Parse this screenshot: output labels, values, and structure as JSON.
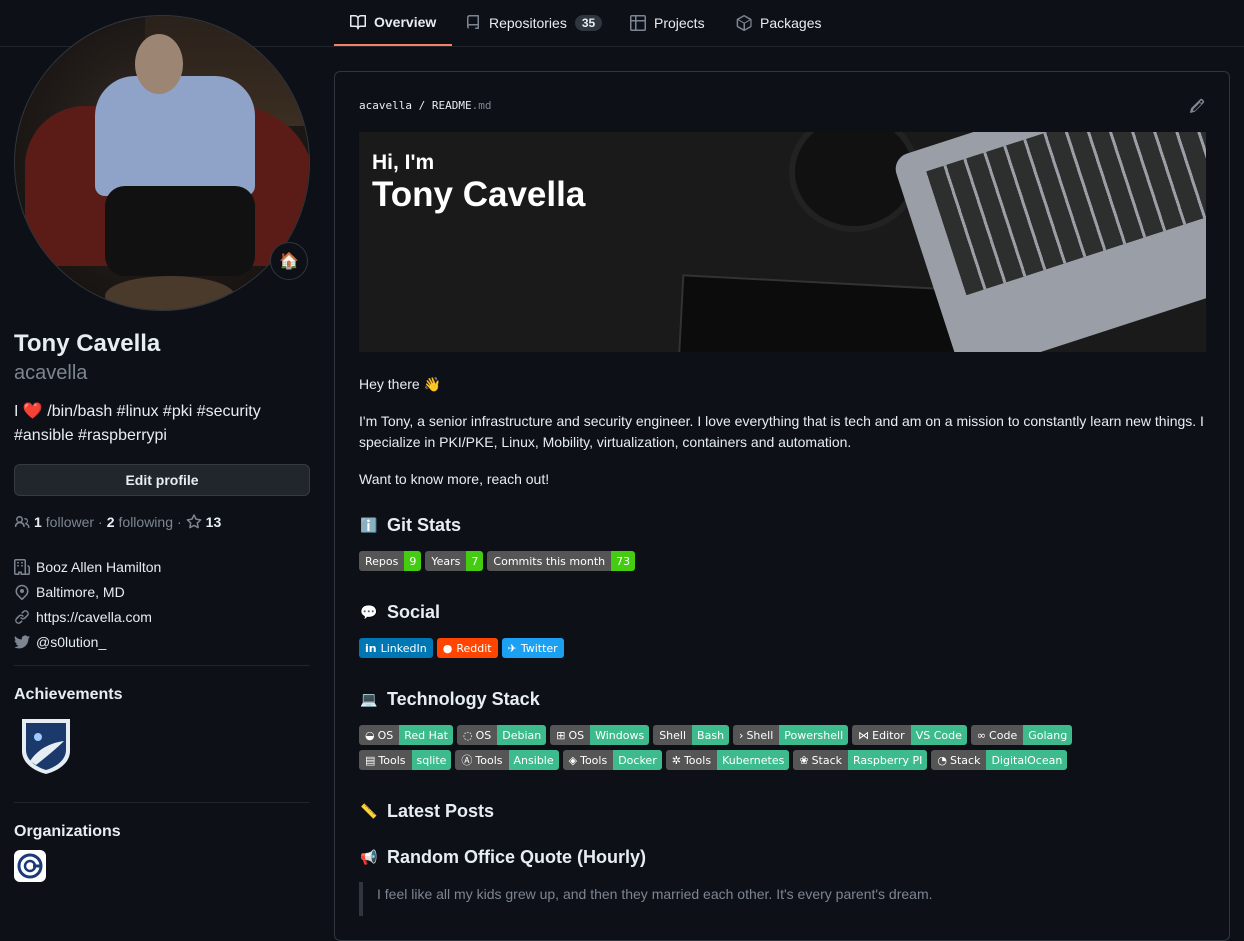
{
  "tabs": [
    {
      "label": "Overview",
      "active": true,
      "icon": "book-icon"
    },
    {
      "label": "Repositories",
      "count": "35",
      "icon": "repo-icon"
    },
    {
      "label": "Projects",
      "icon": "table-icon"
    },
    {
      "label": "Packages",
      "icon": "package-icon"
    }
  ],
  "profile": {
    "status_emoji": "🏠",
    "fullname": "Tony Cavella",
    "username": "acavella",
    "bio_prefix": "I",
    "bio_heart": "❤️",
    "bio_text": "/bin/bash #linux #pki #security #ansible #raspberrypi",
    "edit_label": "Edit profile",
    "followers": "1",
    "followers_label": "follower",
    "following": "2",
    "following_label": "following",
    "dot": "·",
    "stars": "13",
    "company": "Booz Allen Hamilton",
    "location": "Baltimore, MD",
    "website": "https://cavella.com",
    "twitter": "@s0lution_"
  },
  "sidebar": {
    "achievements_title": "Achievements",
    "organizations_title": "Organizations"
  },
  "readme": {
    "owner": "acavella",
    "sep": "/",
    "file": "README",
    "ext": ".md",
    "banner_hi": "Hi, I'm",
    "banner_name": "Tony Cavella",
    "greeting": "Hey there 👋",
    "intro": "I'm Tony, a senior infrastructure and security engineer. I love everything that is tech and am on a mission to constantly learn new things. I specialize in PKI/PKE, Linux, Mobility, virtualization, containers and automation.",
    "reach": "Want to know more, reach out!",
    "git_stats_title": "Git Stats",
    "git_stats_emoji": "ℹ️",
    "git_badges": [
      {
        "label": "Repos",
        "value": "9",
        "color": "#4c1"
      },
      {
        "label": "Years",
        "value": "7",
        "color": "#4c1"
      },
      {
        "label": "Commits this month",
        "value": "73",
        "color": "#4c1"
      }
    ],
    "social_title": "Social",
    "social_emoji": "💬",
    "social_badges": [
      {
        "label": "LinkedIn",
        "icon": "in",
        "color": "#0077b5"
      },
      {
        "label": "Reddit",
        "icon": "●",
        "color": "#ff4500"
      },
      {
        "label": "Twitter",
        "icon": "✈",
        "color": "#1ca0f2"
      }
    ],
    "tech_title": "Technology Stack",
    "tech_emoji": "💻",
    "tech_badges": [
      {
        "icon": "◒",
        "label": "OS",
        "value": "Red Hat"
      },
      {
        "icon": "◌",
        "label": "OS",
        "value": "Debian"
      },
      {
        "icon": "⊞",
        "label": "OS",
        "value": "Windows"
      },
      {
        "icon": "",
        "label": "Shell",
        "value": "Bash"
      },
      {
        "icon": "›",
        "label": "Shell",
        "value": "Powershell"
      },
      {
        "icon": "⋈",
        "label": "Editor",
        "value": "VS Code"
      },
      {
        "icon": "∞",
        "label": "Code",
        "value": "Golang"
      },
      {
        "icon": "▤",
        "label": "Tools",
        "value": "sqlite"
      },
      {
        "icon": "Ⓐ",
        "label": "Tools",
        "value": "Ansible"
      },
      {
        "icon": "◈",
        "label": "Tools",
        "value": "Docker"
      },
      {
        "icon": "✲",
        "label": "Tools",
        "value": "Kubernetes"
      },
      {
        "icon": "❀",
        "label": "Stack",
        "value": "Raspberry PI"
      },
      {
        "icon": "◔",
        "label": "Stack",
        "value": "DigitalOcean"
      }
    ],
    "tech_color": "#3dbb8c",
    "posts_title": "Latest Posts",
    "posts_emoji": "📏",
    "quote_title": "Random Office Quote (Hourly)",
    "quote_emoji": "📢",
    "quote_text": "I feel like all my kids grew up, and then they married each other. It's every parent's dream."
  }
}
